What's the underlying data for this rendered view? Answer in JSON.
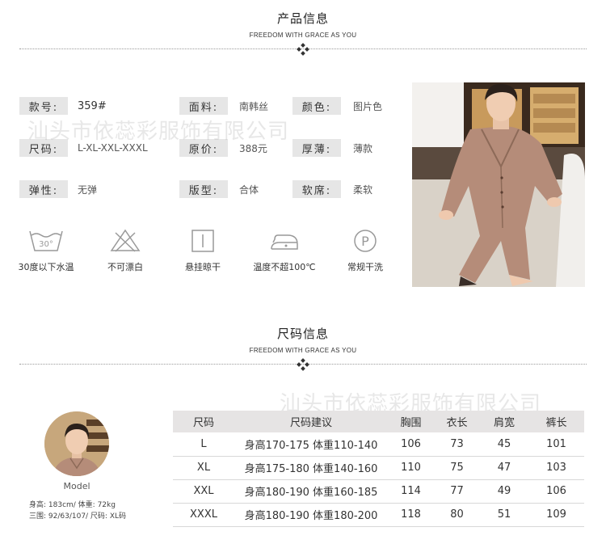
{
  "product_section": {
    "title": "产品信息",
    "subtitle": "FREEDOM WITH GRACE AS YOU"
  },
  "watermark": "汕头市依蕊彩服饰有限公司",
  "specs": [
    {
      "label": "款号:",
      "value": "359#"
    },
    {
      "label": "面料:",
      "value": "南韩丝"
    },
    {
      "label": "颜色:",
      "value": "图片色"
    },
    {
      "label": "尺码:",
      "value": "L-XL-XXL-XXXL"
    },
    {
      "label": "原价:",
      "value": "388元"
    },
    {
      "label": "厚薄:",
      "value": "薄款"
    },
    {
      "label": "弹性:",
      "value": "无弹"
    },
    {
      "label": "版型:",
      "value": "合体"
    },
    {
      "label": "软席:",
      "value": "柔软"
    }
  ],
  "care": [
    {
      "icon": "wash-30-icon",
      "label": "30度以下水温",
      "temp": "30°"
    },
    {
      "icon": "no-bleach-icon",
      "label": "不可漂白"
    },
    {
      "icon": "hang-dry-icon",
      "label": "悬挂晾干"
    },
    {
      "icon": "iron-icon",
      "label": "温度不超100℃"
    },
    {
      "icon": "dry-clean-icon",
      "label": "常规干洗",
      "letter": "P"
    }
  ],
  "size_section": {
    "title": "尺码信息",
    "subtitle": "FREEDOM WITH GRACE AS YOU"
  },
  "model": {
    "name": "Model",
    "line1": "身高: 183cm/ 体重: 72kg",
    "line2": "三围: 92/63/107/ 尺码: XL码"
  },
  "size_table": {
    "headers": [
      "尺码",
      "尺码建议",
      "胸围",
      "衣长",
      "肩宽",
      "裤长"
    ],
    "rows": [
      [
        "L",
        "身高170-175 体重110-140",
        "106",
        "73",
        "45",
        "101"
      ],
      [
        "XL",
        "身高175-180 体重140-160",
        "110",
        "75",
        "47",
        "103"
      ],
      [
        "XXL",
        "身高180-190 体重160-185",
        "114",
        "77",
        "49",
        "106"
      ],
      [
        "XXXL",
        "身高180-190 体重180-200",
        "118",
        "80",
        "51",
        "109"
      ]
    ]
  },
  "colors": {
    "label_bg": "#e6e6e6",
    "header_bg": "#e6e4e4",
    "pajama": "#b58c79"
  }
}
